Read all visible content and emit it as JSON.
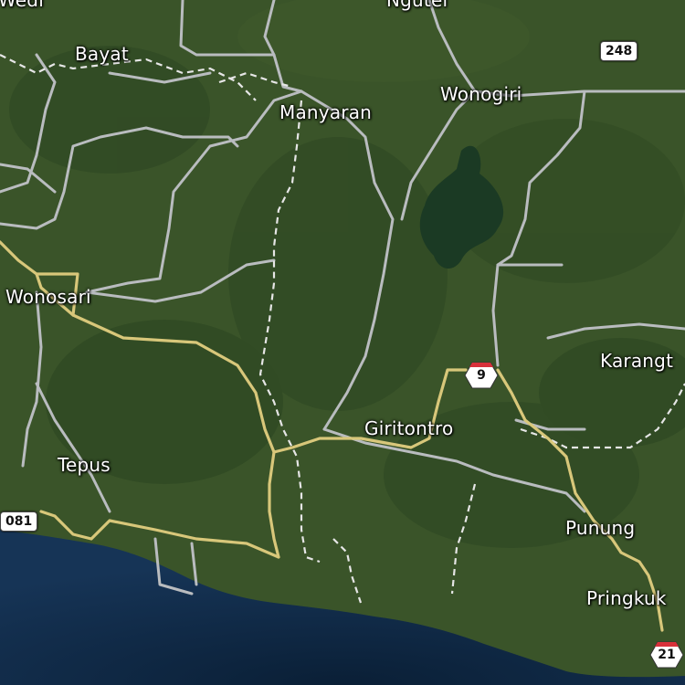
{
  "map": {
    "places": {
      "wedi": "Wedi",
      "ngutel": "Ngutel",
      "bayat": "Bayat",
      "manyaran": "Manyaran",
      "wonogiri": "Wonogiri",
      "wonosari": "Wonosari",
      "karangt": "Karangt",
      "giritontro": "Giritontro",
      "tepus": "Tepus",
      "punung": "Punung",
      "pringkuk": "Pringkuk"
    },
    "shields": {
      "r248": "248",
      "r081": "081",
      "r9": "9",
      "r21": "21"
    },
    "colors": {
      "land": "#36502a",
      "forest": "#2c4522",
      "sea": "#0f2740",
      "reservoir": "#1b3a24",
      "road_major": "#d8c77a",
      "road_minor": "#b9bcbf",
      "boundary": "#e6e6e6"
    }
  }
}
